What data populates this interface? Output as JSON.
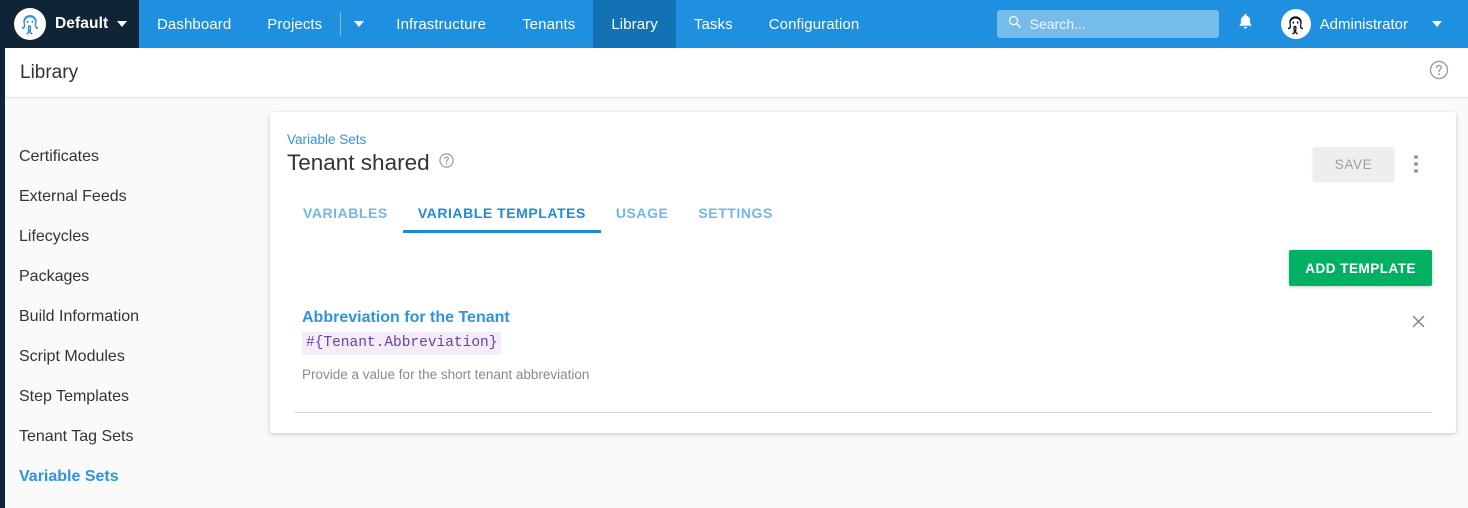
{
  "topnav": {
    "space_name": "Default",
    "space_icon": "octopus-logo-icon",
    "items": [
      {
        "label": "Dashboard",
        "active": false
      },
      {
        "label": "Projects",
        "active": false
      },
      {
        "label": "Infrastructure",
        "active": false
      },
      {
        "label": "Tenants",
        "active": false
      },
      {
        "label": "Library",
        "active": true
      },
      {
        "label": "Tasks",
        "active": false
      },
      {
        "label": "Configuration",
        "active": false
      }
    ],
    "search": {
      "placeholder": "Search...",
      "value": ""
    },
    "user": {
      "name": "Administrator"
    },
    "accent_color": "#1f8fe0",
    "active_tab_color": "#1372b4",
    "dark_color": "#0f2535"
  },
  "pagebar": {
    "title": "Library",
    "help_icon": "help-circle-icon"
  },
  "sidebar": {
    "items": [
      {
        "label": "Certificates",
        "active": false
      },
      {
        "label": "External Feeds",
        "active": false
      },
      {
        "label": "Lifecycles",
        "active": false
      },
      {
        "label": "Packages",
        "active": false
      },
      {
        "label": "Build Information",
        "active": false
      },
      {
        "label": "Script Modules",
        "active": false
      },
      {
        "label": "Step Templates",
        "active": false
      },
      {
        "label": "Tenant Tag Sets",
        "active": false
      },
      {
        "label": "Variable Sets",
        "active": true
      }
    ]
  },
  "card": {
    "breadcrumb": "Variable Sets",
    "title": "Tenant shared",
    "title_help_icon": "help-circle-icon",
    "save_label": "SAVE",
    "save_disabled": true,
    "overflow_icon": "vertical-dots-icon",
    "tabs": [
      {
        "label": "VARIABLES",
        "active": false
      },
      {
        "label": "VARIABLE TEMPLATES",
        "active": true
      },
      {
        "label": "USAGE",
        "active": false
      },
      {
        "label": "SETTINGS",
        "active": false
      }
    ],
    "add_template_label": "ADD TEMPLATE",
    "add_template_color": "#00b163",
    "templates": [
      {
        "name": "Abbreviation for the Tenant",
        "code": "#{Tenant.Abbreviation}",
        "help": "Provide a value for the short tenant abbreviation",
        "remove_icon": "close-icon"
      }
    ]
  }
}
